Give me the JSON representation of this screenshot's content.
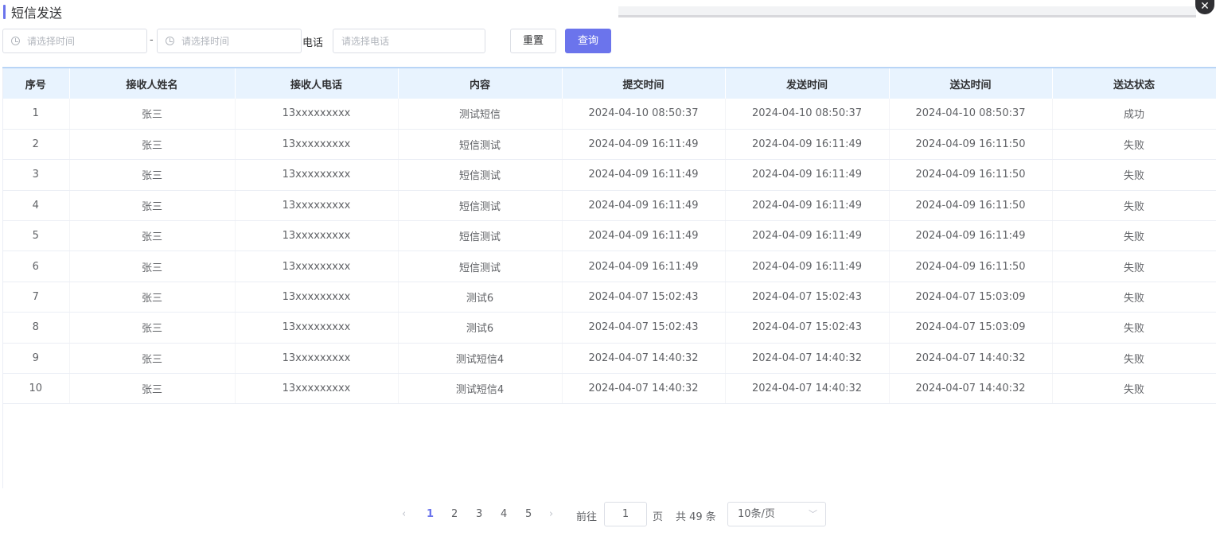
{
  "title": "短信发送",
  "filters": {
    "start_placeholder": "请选择时间",
    "range_sep": "-",
    "end_placeholder": "请选择时间",
    "phone_label": "电话",
    "phone_placeholder": "请选择电话",
    "reset_label": "重置",
    "query_label": "查询"
  },
  "table": {
    "columns": [
      "序号",
      "接收人姓名",
      "接收人电话",
      "内容",
      "提交时间",
      "发送时间",
      "送达时间",
      "送达状态"
    ],
    "rows": [
      [
        "1",
        "张三",
        "13xxxxxxxxx",
        "测试短信",
        "2024-04-10 08:50:37",
        "2024-04-10 08:50:37",
        "2024-04-10 08:50:37",
        "成功"
      ],
      [
        "2",
        "张三",
        "13xxxxxxxxx",
        "短信测试",
        "2024-04-09 16:11:49",
        "2024-04-09 16:11:49",
        "2024-04-09 16:11:50",
        "失败"
      ],
      [
        "3",
        "张三",
        "13xxxxxxxxx",
        "短信测试",
        "2024-04-09 16:11:49",
        "2024-04-09 16:11:49",
        "2024-04-09 16:11:50",
        "失败"
      ],
      [
        "4",
        "张三",
        "13xxxxxxxxx",
        "短信测试",
        "2024-04-09 16:11:49",
        "2024-04-09 16:11:49",
        "2024-04-09 16:11:50",
        "失败"
      ],
      [
        "5",
        "张三",
        "13xxxxxxxxx",
        "短信测试",
        "2024-04-09 16:11:49",
        "2024-04-09 16:11:49",
        "2024-04-09 16:11:49",
        "失败"
      ],
      [
        "6",
        "张三",
        "13xxxxxxxxx",
        "短信测试",
        "2024-04-09 16:11:49",
        "2024-04-09 16:11:49",
        "2024-04-09 16:11:50",
        "失败"
      ],
      [
        "7",
        "张三",
        "13xxxxxxxxx",
        "测试6",
        "2024-04-07 15:02:43",
        "2024-04-07 15:02:43",
        "2024-04-07 15:03:09",
        "失败"
      ],
      [
        "8",
        "张三",
        "13xxxxxxxxx",
        "测试6",
        "2024-04-07 15:02:43",
        "2024-04-07 15:02:43",
        "2024-04-07 15:03:09",
        "失败"
      ],
      [
        "9",
        "张三",
        "13xxxxxxxxx",
        "测试短信4",
        "2024-04-07 14:40:32",
        "2024-04-07 14:40:32",
        "2024-04-07 14:40:32",
        "失败"
      ],
      [
        "10",
        "张三",
        "13xxxxxxxxx",
        "测试短信4",
        "2024-04-07 14:40:32",
        "2024-04-07 14:40:32",
        "2024-04-07 14:40:32",
        "失败"
      ]
    ]
  },
  "pagination": {
    "prev": "‹",
    "next": "›",
    "pages": [
      "1",
      "2",
      "3",
      "4",
      "5"
    ],
    "current": "1",
    "goto_label": "前往",
    "goto_value": "1",
    "page_unit": "页",
    "total_text": "共 49 条",
    "page_size": "10条/页"
  },
  "icons": {
    "close": "close-icon",
    "clock": "clock-icon",
    "chevron": "chevron-down-icon"
  },
  "colors": {
    "accent": "#6b74ec",
    "header_bg": "#e8f3fe"
  }
}
